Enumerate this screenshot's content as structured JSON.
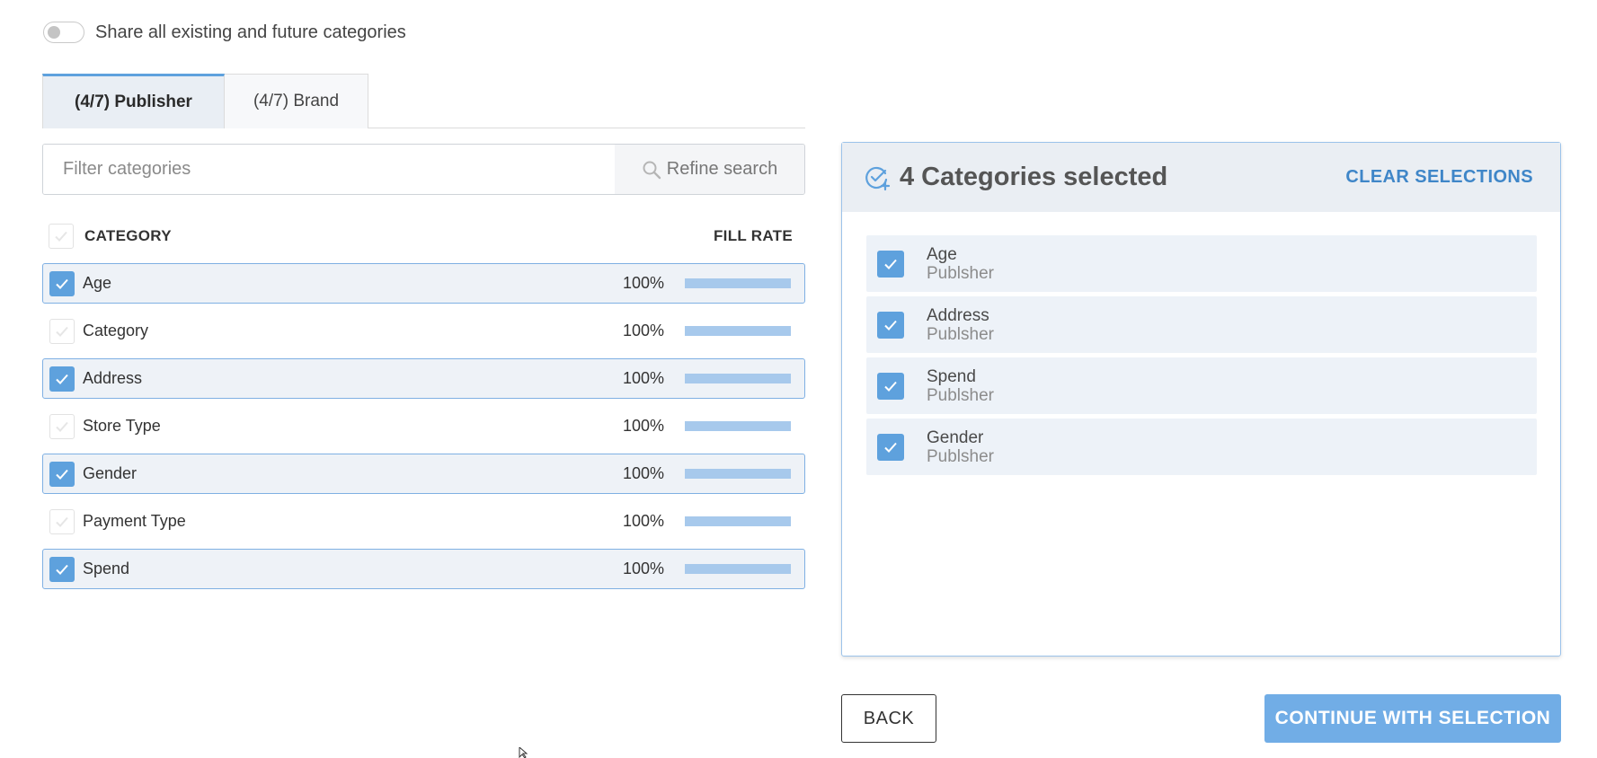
{
  "share_toggle": {
    "label": "Share all existing and future categories",
    "on": false
  },
  "tabs": [
    {
      "label": "(4/7) Publisher",
      "active": true
    },
    {
      "label": "(4/7) Brand",
      "active": false
    }
  ],
  "filter": {
    "placeholder": "Filter categories",
    "value": "",
    "refine_label": "Refine search"
  },
  "table": {
    "columns": {
      "category": "CATEGORY",
      "fill_rate": "FILL RATE"
    },
    "rows": [
      {
        "label": "Age",
        "fill_rate": "100%",
        "fill_fraction": 1.0,
        "selected": true
      },
      {
        "label": "Category",
        "fill_rate": "100%",
        "fill_fraction": 1.0,
        "selected": false
      },
      {
        "label": "Address",
        "fill_rate": "100%",
        "fill_fraction": 1.0,
        "selected": true
      },
      {
        "label": "Store Type",
        "fill_rate": "100%",
        "fill_fraction": 1.0,
        "selected": false
      },
      {
        "label": "Gender",
        "fill_rate": "100%",
        "fill_fraction": 1.0,
        "selected": true
      },
      {
        "label": "Payment Type",
        "fill_rate": "100%",
        "fill_fraction": 1.0,
        "selected": false
      },
      {
        "label": "Spend",
        "fill_rate": "100%",
        "fill_fraction": 1.0,
        "selected": true
      }
    ]
  },
  "selection_panel": {
    "title": "4 Categories selected",
    "clear_label": "CLEAR SELECTIONS",
    "items": [
      {
        "name": "Age",
        "source": "Publsher"
      },
      {
        "name": "Address",
        "source": "Publsher"
      },
      {
        "name": "Spend",
        "source": "Publsher"
      },
      {
        "name": "Gender",
        "source": "Publsher"
      }
    ]
  },
  "buttons": {
    "back": "BACK",
    "continue": "CONTINUE WITH SELECTION"
  },
  "colors": {
    "accent": "#5ea1dd",
    "continue_bg": "#71ade6",
    "clear_text": "#3f86c8",
    "selected_row_bg": "#eef2f7"
  }
}
